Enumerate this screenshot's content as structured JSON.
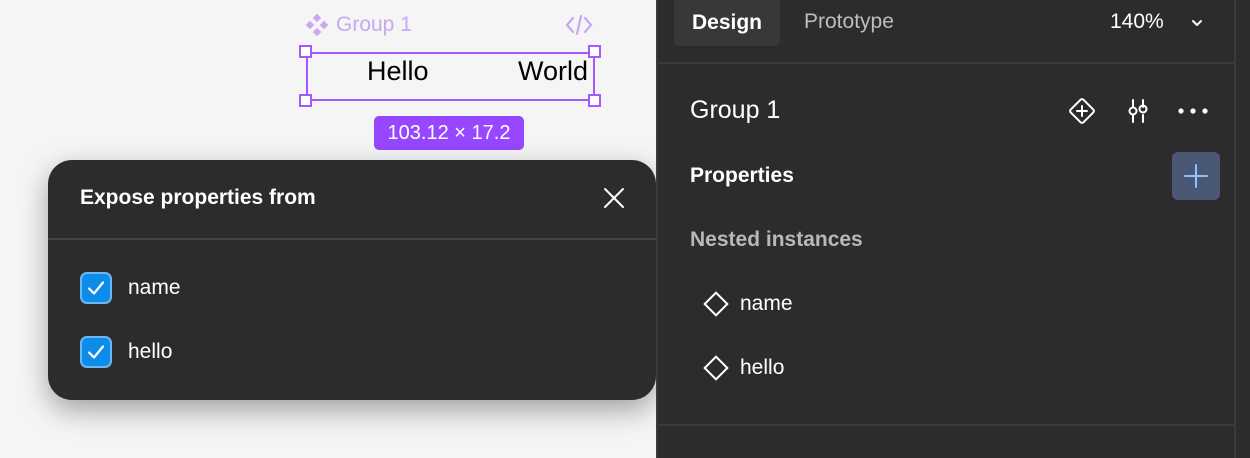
{
  "canvas": {
    "group_label": "Group 1",
    "text_left": "Hello",
    "text_right": "World",
    "dimensions": "103.12 × 17.2",
    "icons": [
      "component-set-icon",
      "code-icon"
    ]
  },
  "popover": {
    "title": "Expose properties from",
    "items": [
      {
        "label": "name",
        "checked": true
      },
      {
        "label": "hello",
        "checked": true
      }
    ]
  },
  "panel": {
    "tabs": {
      "design": "Design",
      "prototype": "Prototype"
    },
    "active_tab": "Design",
    "zoom": "140%",
    "title": "Group 1",
    "properties_label": "Properties",
    "nested_label": "Nested instances",
    "nested_items": [
      "name",
      "hello"
    ]
  },
  "colors": {
    "selection": "#a259ff",
    "badge": "#9747ff",
    "checkbox": "#0c8ce9",
    "panel_bg": "#2c2c2c"
  }
}
